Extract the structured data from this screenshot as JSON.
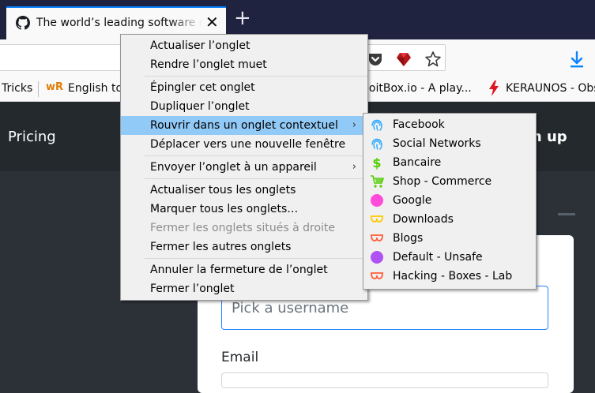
{
  "tab": {
    "title": "The world’s leading software development platform · GitHub",
    "favicon": "github-icon"
  },
  "toolbar": {
    "icons": [
      "pocket-icon",
      "ruby-icon",
      "bookmark-star-icon",
      "download-icon"
    ]
  },
  "bookmarks": [
    "Tricks",
    "English to",
    "loitBox.io - A play...",
    "KERAUNOS - Obs"
  ],
  "page": {
    "nav_pricing": "Pricing",
    "nav_signup": "gn up",
    "username_placeholder": "Pick a username",
    "email_label": "Email"
  },
  "context_menu": {
    "items": [
      {
        "label": "Actualiser l’onglet"
      },
      {
        "label": "Rendre l’onglet muet"
      },
      {
        "label": "Épingler cet onglet"
      },
      {
        "label": "Dupliquer l’onglet"
      },
      {
        "label": "Rouvrir dans un onglet contextuel",
        "submenu": true
      },
      {
        "label": "Déplacer vers une nouvelle fenêtre"
      },
      {
        "label": "Envoyer l’onglet à un appareil",
        "submenu": true
      },
      {
        "label": "Actualiser tous les onglets"
      },
      {
        "label": "Marquer tous les onglets…"
      },
      {
        "label": "Fermer les onglets situés à droite",
        "disabled": true
      },
      {
        "label": "Fermer les autres onglets"
      },
      {
        "label": "Annuler la fermeture de l’onglet"
      },
      {
        "label": "Fermer l’onglet"
      }
    ],
    "arrow": "›"
  },
  "container_menu": {
    "items": [
      {
        "label": "Facebook",
        "icon": "fingerprint-icon",
        "color": "#37adff"
      },
      {
        "label": "Social Networks",
        "icon": "fingerprint-icon",
        "color": "#37adff"
      },
      {
        "label": "Bancaire",
        "icon": "dollar-icon",
        "color": "#51cd00"
      },
      {
        "label": "Shop - Commerce",
        "icon": "cart-icon",
        "color": "#51cd00"
      },
      {
        "label": "Google",
        "icon": "circle-icon",
        "color": "#ff4bda"
      },
      {
        "label": "Downloads",
        "icon": "glasses-icon",
        "color": "#ffcb00"
      },
      {
        "label": "Blogs",
        "icon": "glasses-icon",
        "color": "#ff613d"
      },
      {
        "label": "Default - Unsafe",
        "icon": "circle-icon",
        "color": "#af51f5"
      },
      {
        "label": "Hacking - Boxes - Lab",
        "icon": "glasses-icon",
        "color": "#ff613d"
      }
    ]
  },
  "colors": {
    "tabstrip": "#202340",
    "accent": "#0a84ff",
    "menu_highlight": "#91c9f7"
  }
}
